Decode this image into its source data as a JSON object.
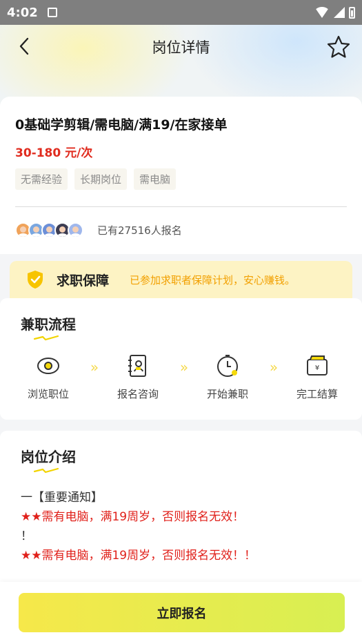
{
  "status_bar": {
    "time": "4:02"
  },
  "nav": {
    "title": "岗位详情"
  },
  "job": {
    "title": "0基础学剪辑/需电脑/满19/在家接单",
    "salary": "30-180 元/次",
    "tags": [
      "无需经验",
      "长期岗位",
      "需电脑"
    ],
    "applicants_text": "已有27516人报名"
  },
  "guarantee": {
    "title": "求职保障",
    "desc": "已参加求职者保障计划，安心赚钱。"
  },
  "process": {
    "title": "兼职流程",
    "steps": [
      "浏览职位",
      "报名咨询",
      "开始兼职",
      "完工结算"
    ]
  },
  "intro": {
    "title": "岗位介绍",
    "lines": [
      "一【重要通知】",
      "★★需有电脑，满19周岁，否则报名无效！",
      "！",
      "★★需有电脑，满19周岁，否则报名无效！！"
    ]
  },
  "apply_label": "立即报名",
  "colors": {
    "accent_red": "#e02b1e",
    "accent_yellow": "#f6e84a",
    "guarantee_text": "#f2a000"
  }
}
